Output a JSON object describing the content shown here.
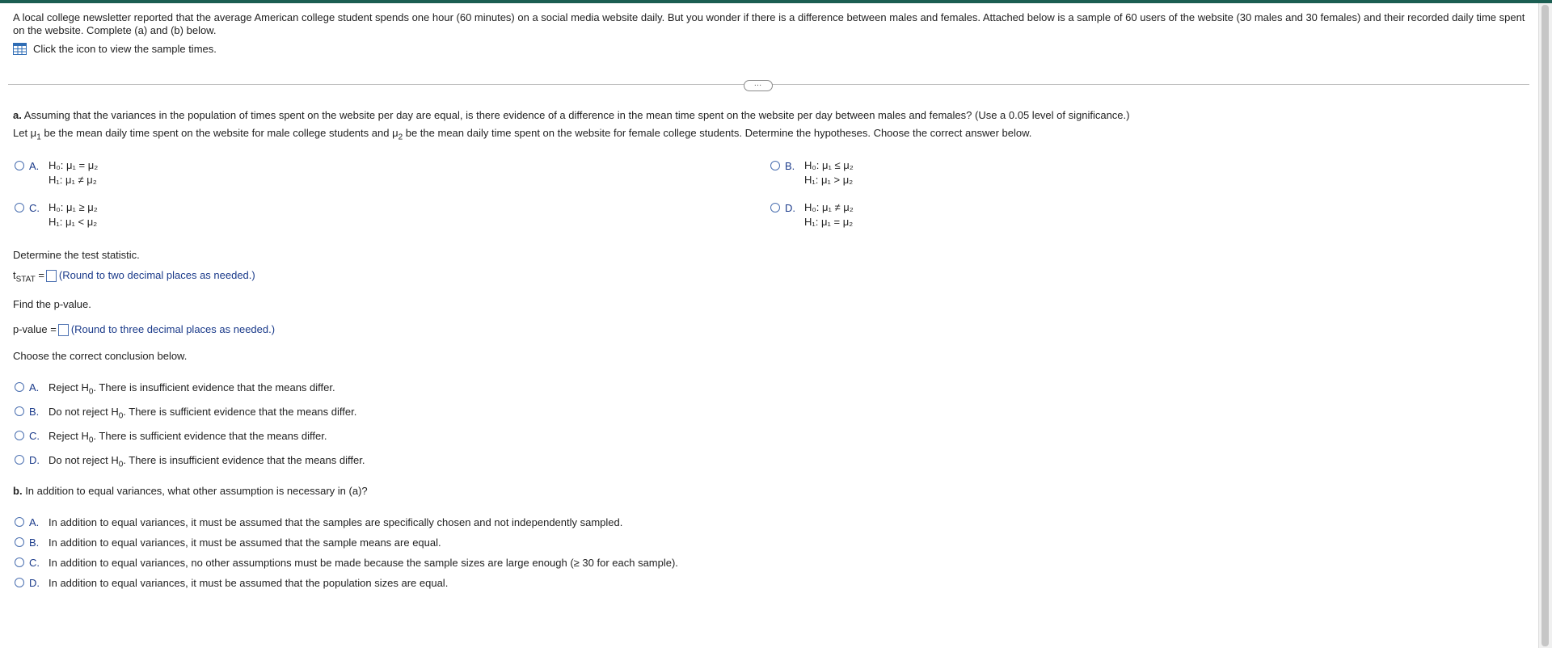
{
  "intro": {
    "text": "A local college newsletter reported that the average American college student spends one hour (60 minutes) on a social media website daily. But you wonder if there is a difference between males and females. Attached below is a sample of 60 users of the website (30 males and 30 females) and their recorded daily time spent on the website. Complete (a) and (b) below.",
    "icon_text": "Click the icon to view the sample times."
  },
  "expander_label": "…",
  "part_a": {
    "label": "a.",
    "question": "Assuming that the variances in the population of times spent on the website per day are equal, is there evidence of a difference in the mean time spent on the website per day between males and females? (Use a 0.05 level of significance.)",
    "let_pre": "Let μ",
    "let_mid": " be the mean daily time spent on the website for male college students and μ",
    "let_post": " be the mean daily time spent on the website for female college students. Determine the hypotheses. Choose the correct answer below.",
    "hypotheses": [
      {
        "letter": "A.",
        "h0": "H₀: μ₁ = μ₂",
        "h1": "H₁: μ₁ ≠ μ₂"
      },
      {
        "letter": "B.",
        "h0": "H₀: μ₁ ≤ μ₂",
        "h1": "H₁: μ₁ > μ₂"
      },
      {
        "letter": "C.",
        "h0": "H₀: μ₁ ≥ μ₂",
        "h1": "H₁: μ₁ < μ₂"
      },
      {
        "letter": "D.",
        "h0": "H₀: μ₁ ≠ μ₂",
        "h1": "H₁: μ₁ = μ₂"
      }
    ],
    "test_stat_prompt": "Determine the test statistic.",
    "tstat_label": "t",
    "tstat_sub": "STAT",
    "tstat_eq": " =",
    "tstat_hint": "(Round to two decimal places as needed.)",
    "pvalue_prompt": "Find the p-value.",
    "pvalue_label": "p-value =",
    "pvalue_hint": "(Round to three decimal places as needed.)",
    "conclusion_prompt": "Choose the correct conclusion below.",
    "conclusions": [
      {
        "letter": "A.",
        "pre": "Reject H",
        "post": ". There is insufficient evidence that the means differ."
      },
      {
        "letter": "B.",
        "pre": "Do not reject H",
        "post": ". There is sufficient evidence that the means differ."
      },
      {
        "letter": "C.",
        "pre": "Reject H",
        "post": ". There is sufficient evidence that the means differ."
      },
      {
        "letter": "D.",
        "pre": "Do not reject H",
        "post": ". There is insufficient evidence that the means differ."
      }
    ]
  },
  "part_b": {
    "label": "b.",
    "question": "In addition to equal variances, what other assumption is necessary in (a)?",
    "options": [
      {
        "letter": "A.",
        "text": "In addition to equal variances, it must be assumed that the samples are specifically chosen and not independently sampled."
      },
      {
        "letter": "B.",
        "text": "In addition to equal variances, it must be assumed that the sample means are equal."
      },
      {
        "letter": "C.",
        "text": "In addition to equal variances, no other assumptions must be made because the sample sizes are large enough (≥ 30 for each sample)."
      },
      {
        "letter": "D.",
        "text": "In addition to equal variances, it must be assumed that the population sizes are equal."
      }
    ]
  }
}
